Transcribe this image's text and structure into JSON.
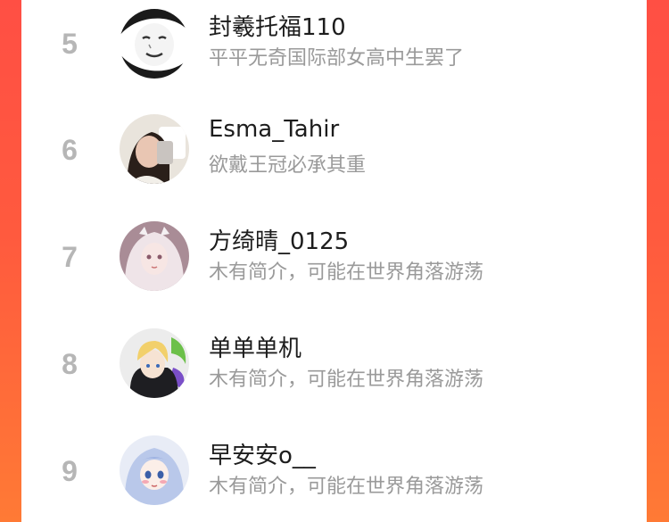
{
  "users": [
    {
      "rank": "5",
      "name": "封羲托福110",
      "bio": "平平无奇国际部女高中生罢了",
      "avatar_icon": "meme-face-avatar"
    },
    {
      "rank": "6",
      "name": "Esma_Tahir",
      "bio": "欲戴王冠必承其重",
      "avatar_icon": "selfie-photo-avatar"
    },
    {
      "rank": "7",
      "name": "方绮晴_0125",
      "bio": "木有简介，可能在世界角落游荡",
      "avatar_icon": "anime-girl-avatar"
    },
    {
      "rank": "8",
      "name": "单单单机",
      "bio": "木有简介，可能在世界角落游荡",
      "avatar_icon": "anime-boy-avatar"
    },
    {
      "rank": "9",
      "name": "早安安o__",
      "bio": "木有简介，可能在世界角落游荡",
      "avatar_icon": "anime-blue-hair-avatar"
    }
  ],
  "colors": {
    "rank": "#b6b6b6",
    "name": "#1d1d1d",
    "bio": "#9a9a9a",
    "background_gradient_start": "#ff4f44",
    "background_gradient_end": "#ff7a35"
  }
}
